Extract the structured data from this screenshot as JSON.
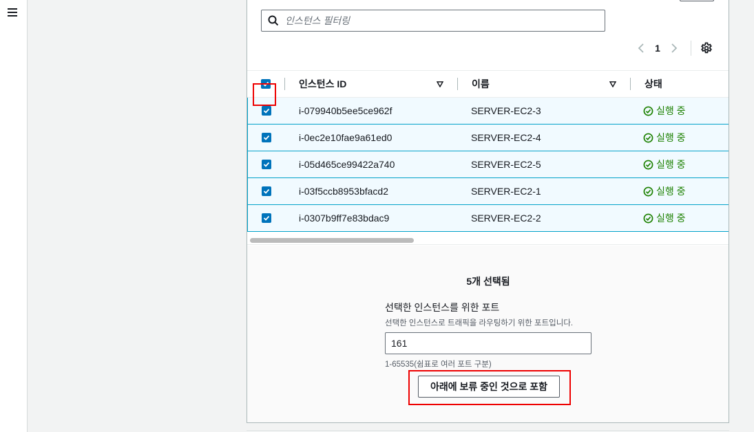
{
  "filter": {
    "placeholder": "인스턴스 필터링"
  },
  "pagination": {
    "current_page": "1"
  },
  "table": {
    "columns": [
      "인스턴스 ID",
      "이름",
      "상태"
    ],
    "rows": [
      {
        "id": "i-079940b5ee5ce962f",
        "name": "SERVER-EC2-3",
        "state": "실행 중"
      },
      {
        "id": "i-0ec2e10fae9a61ed0",
        "name": "SERVER-EC2-4",
        "state": "실행 중"
      },
      {
        "id": "i-05d465ce99422a740",
        "name": "SERVER-EC2-5",
        "state": "실행 중"
      },
      {
        "id": "i-03f5ccb8953bfacd2",
        "name": "SERVER-EC2-1",
        "state": "실행 중"
      },
      {
        "id": "i-0307b9ff7e83bdac9",
        "name": "SERVER-EC2-2",
        "state": "실행 중"
      }
    ]
  },
  "selection": {
    "count_label": "5개 선택됨"
  },
  "port_form": {
    "label": "선택한 인스턴스를 위한 포트",
    "description": "선택한 인스턴스로 트래픽을 라우팅하기 위한 포트입니다.",
    "value": "161",
    "hint": "1-65535(쉼표로 여러 포트 구분)"
  },
  "include_button": {
    "label": "아래에 보류 중인 것으로 포함"
  },
  "colors": {
    "accent": "#0073bb",
    "running": "#1d8102",
    "highlight": "#e00000",
    "selected_row_bg": "#f1faff",
    "selected_row_border": "#00a1c9"
  },
  "icons": [
    "menu-icon",
    "search-icon",
    "chevron-left-icon",
    "chevron-right-icon",
    "gear-icon",
    "sort-icon",
    "check-icon",
    "status-ok-icon"
  ]
}
